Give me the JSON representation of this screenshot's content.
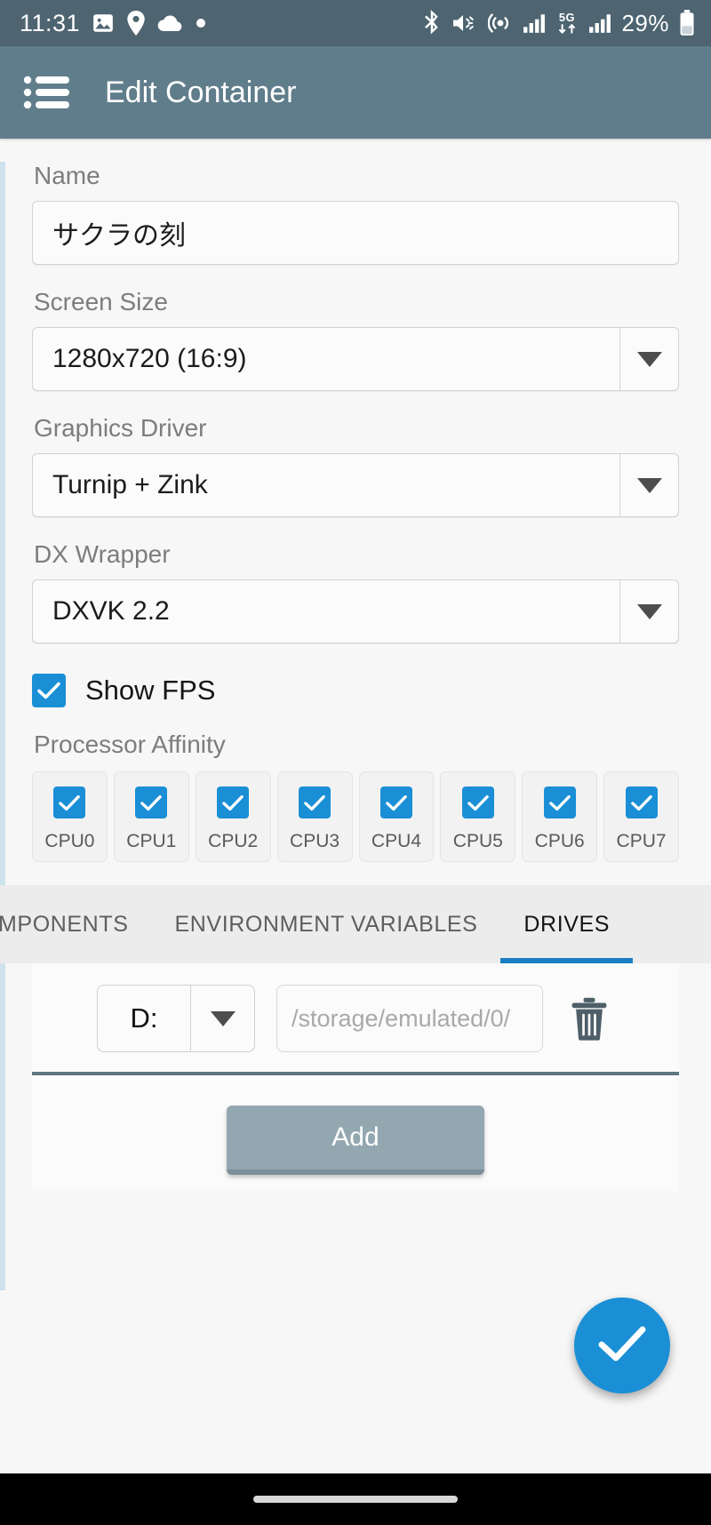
{
  "statusbar": {
    "time": "11:31",
    "battery_percent": "29%",
    "left_icons": [
      "image-icon",
      "location-pin-icon",
      "cloud-icon",
      "dot-icon"
    ],
    "right_icons": [
      "bluetooth-icon",
      "volume-mute-icon",
      "hotspot-icon",
      "signal-bars-icon",
      "network-5g-icon",
      "signal-bars-2-icon",
      "battery-icon"
    ],
    "network_type": "5G",
    "bg_color": "#4e6571"
  },
  "appbar": {
    "menu_icon": "list-menu-icon",
    "title": "Edit Container",
    "bg_color": "#607d8b"
  },
  "form": {
    "name": {
      "label": "Name",
      "value": "サクラの刻"
    },
    "screen_size": {
      "label": "Screen Size",
      "value": "1280x720 (16:9)"
    },
    "graphics_driver": {
      "label": "Graphics Driver",
      "value": "Turnip + Zink"
    },
    "dx_wrapper": {
      "label": "DX Wrapper",
      "value": "DXVK 2.2"
    },
    "show_fps": {
      "label": "Show FPS",
      "checked": true
    },
    "processor_affinity": {
      "label": "Processor Affinity",
      "cpus": [
        {
          "label": "CPU0",
          "checked": true
        },
        {
          "label": "CPU1",
          "checked": true
        },
        {
          "label": "CPU2",
          "checked": true
        },
        {
          "label": "CPU3",
          "checked": true
        },
        {
          "label": "CPU4",
          "checked": true
        },
        {
          "label": "CPU5",
          "checked": true
        },
        {
          "label": "CPU6",
          "checked": true
        },
        {
          "label": "CPU7",
          "checked": true
        }
      ]
    }
  },
  "tabs": [
    {
      "label": "MPONENTS",
      "active": false
    },
    {
      "label": "ENVIRONMENT VARIABLES",
      "active": false
    },
    {
      "label": "DRIVES",
      "active": true
    }
  ],
  "drives": {
    "rows": [
      {
        "letter": "D:",
        "path_value": "",
        "path_placeholder": "/storage/emulated/0/",
        "delete_icon": "trash-icon"
      }
    ],
    "add_label": "Add"
  },
  "fab": {
    "icon": "check-icon",
    "color": "#1a8fd6"
  },
  "colors": {
    "accent": "#1a8fd6",
    "appbar": "#607d8b",
    "statusbar": "#4e6571",
    "tab_underline": "#1a7fc4",
    "add_button": "#93a7b0"
  }
}
